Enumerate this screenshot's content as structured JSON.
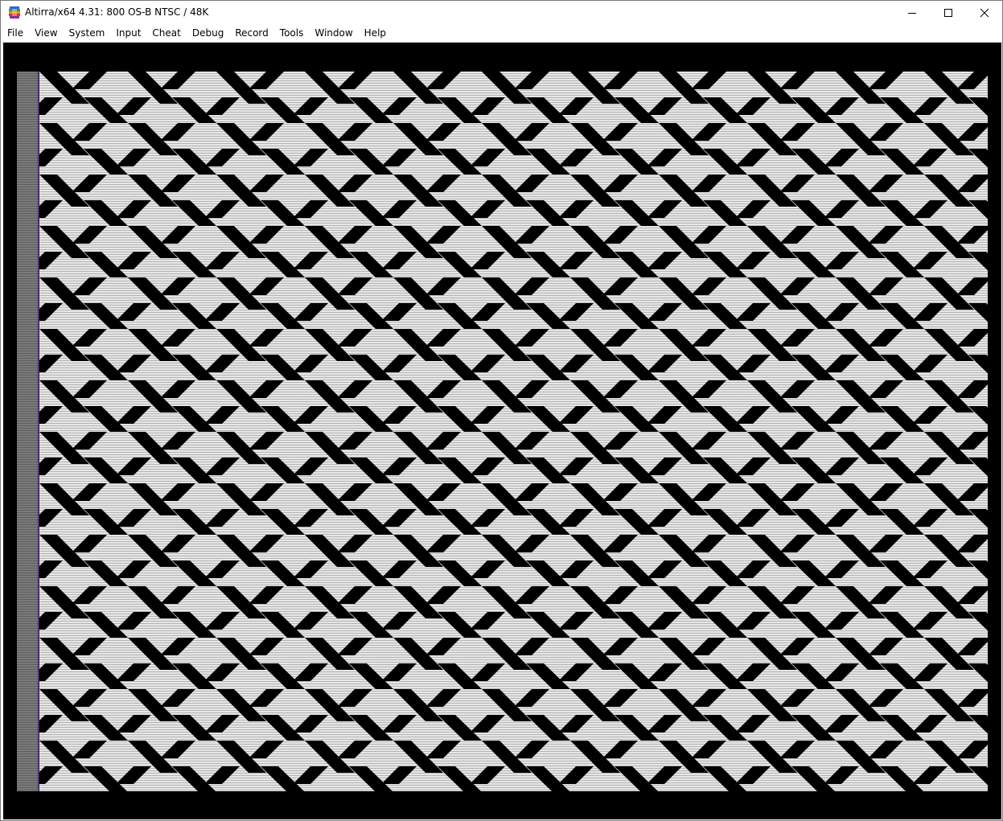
{
  "window": {
    "title": "Altirra/x64 4.31: 800 OS-B NTSC / 48K"
  },
  "menu": [
    {
      "label": "File"
    },
    {
      "label": "View"
    },
    {
      "label": "System"
    },
    {
      "label": "Input"
    },
    {
      "label": "Cheat"
    },
    {
      "label": "Debug"
    },
    {
      "label": "Record"
    },
    {
      "label": "Tools"
    },
    {
      "label": "Window"
    },
    {
      "label": "Help"
    }
  ],
  "colors": {
    "pattern_light": "#e6e6e6",
    "pattern_dark": "#000000",
    "border": "#7a7a7a",
    "fringe": "#6a3fa5"
  },
  "icons": {
    "app": "altirra-app-icon",
    "minimize": "minimize-icon",
    "maximize": "maximize-icon",
    "close": "close-icon"
  }
}
